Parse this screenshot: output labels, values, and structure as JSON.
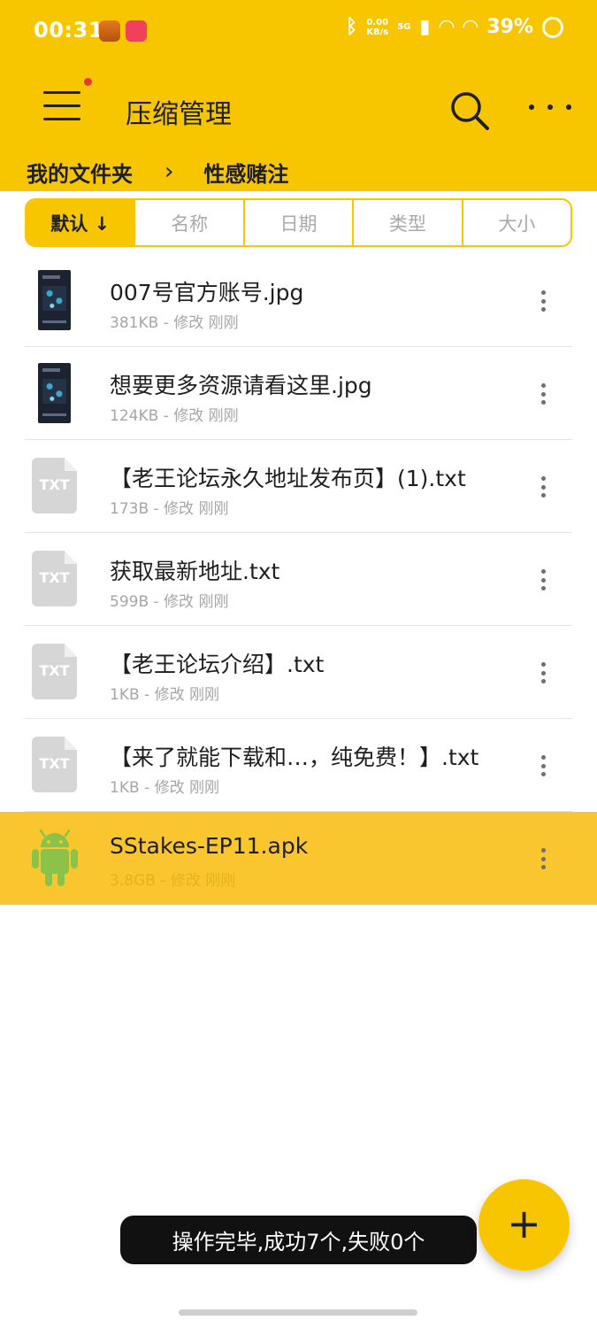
{
  "status_bar": {
    "time": "00:31",
    "bluetooth_icon": "bluetooth-icon",
    "speed_value": "0.00",
    "speed_unit": "KB/s",
    "network_type": "5G",
    "battery_text": "39%"
  },
  "appbar": {
    "title": "压缩管理"
  },
  "breadcrumb": {
    "parent": "我的文件夹",
    "separator": "›",
    "current": "性感赌注"
  },
  "sort_tabs": [
    {
      "label": "默认 ↓",
      "active": true
    },
    {
      "label": "名称",
      "active": false
    },
    {
      "label": "日期",
      "active": false
    },
    {
      "label": "类型",
      "active": false
    },
    {
      "label": "大小",
      "active": false
    }
  ],
  "files": [
    {
      "name": "007号官方账号.jpg",
      "meta": "381KB - 修改 刚刚",
      "icon": "image-thumbnail-icon"
    },
    {
      "name": "想要更多资源请看这里.jpg",
      "meta": "124KB - 修改 刚刚",
      "icon": "image-thumbnail-icon"
    },
    {
      "name": "【老王论坛永久地址发布页】(1).txt",
      "meta": "173B - 修改 刚刚",
      "icon": "txt-file-icon",
      "icon_label": "TXT"
    },
    {
      "name": "获取最新地址.txt",
      "meta": "599B - 修改 刚刚",
      "icon": "txt-file-icon",
      "icon_label": "TXT"
    },
    {
      "name": "【老王论坛介绍】.txt",
      "meta": "1KB - 修改 刚刚",
      "icon": "txt-file-icon",
      "icon_label": "TXT"
    },
    {
      "name": "【来了就能下载和…，纯免费！】.txt",
      "meta": "1KB - 修改 刚刚",
      "icon": "txt-file-icon",
      "icon_label": "TXT"
    },
    {
      "name": "SStakes-EP11.apk",
      "meta": "3.8GB - 修改 刚刚",
      "icon": "android-icon",
      "selected": true
    }
  ],
  "fab": {
    "label": "+"
  },
  "toast": {
    "text": "操作完毕,成功7个,失败0个"
  },
  "colors": {
    "primary": "#F8C600",
    "highlight_row": "#F9C62F",
    "android_green": "#8BC34A"
  }
}
